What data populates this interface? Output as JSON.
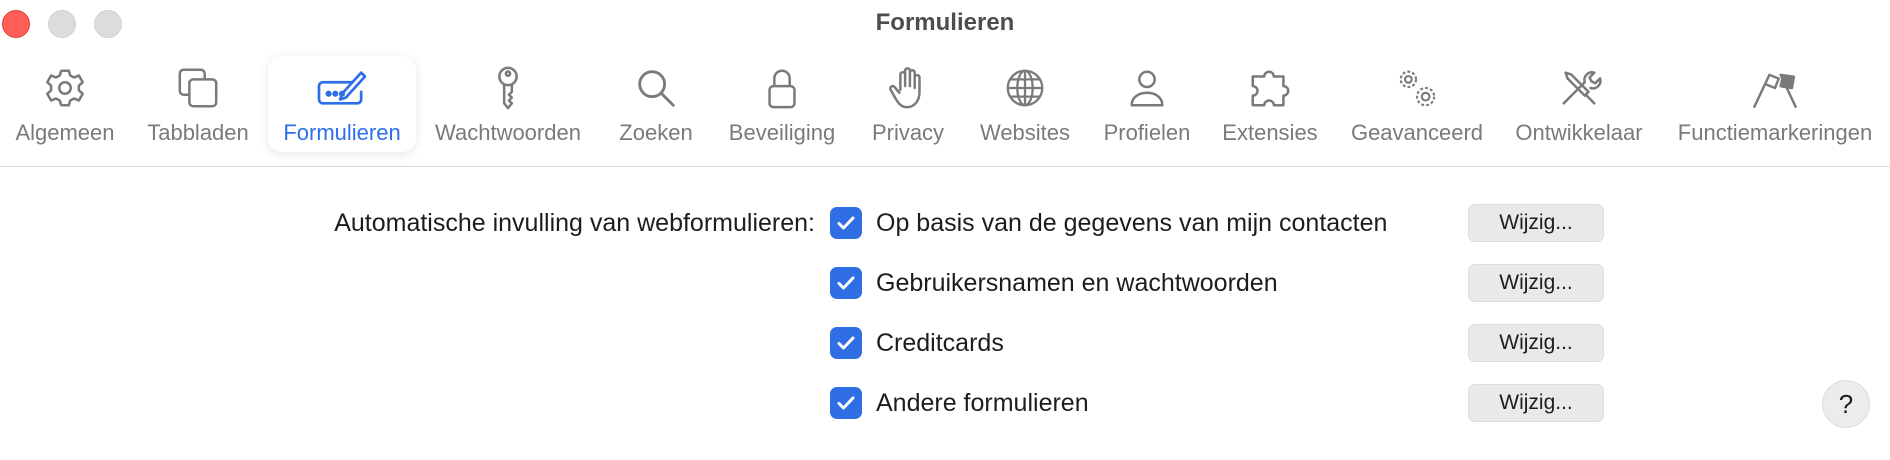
{
  "window": {
    "title": "Formulieren"
  },
  "toolbar": {
    "items": [
      {
        "label": "Algemeen",
        "icon": "gear-icon"
      },
      {
        "label": "Tabbladen",
        "icon": "tabs-icon"
      },
      {
        "label": "Formulieren",
        "icon": "form-pencil-icon",
        "selected": true
      },
      {
        "label": "Wachtwoorden",
        "icon": "key-icon"
      },
      {
        "label": "Zoeken",
        "icon": "search-icon"
      },
      {
        "label": "Beveiliging",
        "icon": "lock-icon"
      },
      {
        "label": "Privacy",
        "icon": "hand-icon"
      },
      {
        "label": "Websites",
        "icon": "globe-icon"
      },
      {
        "label": "Profielen",
        "icon": "person-icon"
      },
      {
        "label": "Extensies",
        "icon": "puzzle-icon"
      },
      {
        "label": "Geavanceerd",
        "icon": "gears-icon"
      },
      {
        "label": "Ontwikkelaar",
        "icon": "tools-icon"
      },
      {
        "label": "Functiemarkeringen",
        "icon": "flags-icon"
      }
    ]
  },
  "autofill": {
    "label": "Automatische invulling van webformulieren:",
    "options": [
      {
        "label": "Op basis van de gegevens van mijn contacten",
        "checked": true,
        "button": "Wijzig..."
      },
      {
        "label": "Gebruikersnamen en wachtwoorden",
        "checked": true,
        "button": "Wijzig..."
      },
      {
        "label": "Creditcards",
        "checked": true,
        "button": "Wijzig..."
      },
      {
        "label": "Andere formulieren",
        "checked": true,
        "button": "Wijzig..."
      }
    ]
  },
  "help": {
    "label": "?"
  },
  "colors": {
    "accent": "#2f6ee5",
    "close": "#ff5f57",
    "icon_gray": "#7a7a7a"
  }
}
